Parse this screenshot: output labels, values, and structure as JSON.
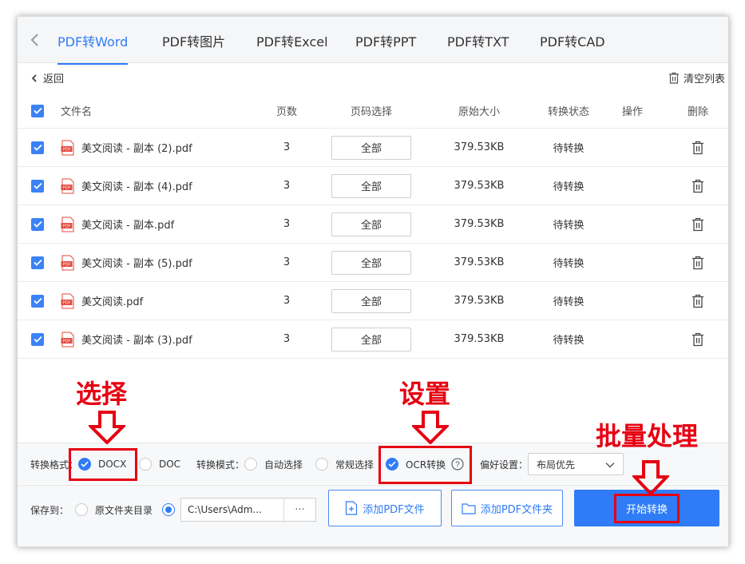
{
  "tabs": [
    {
      "label": "PDF转Word",
      "active": true
    },
    {
      "label": "PDF转图片",
      "active": false
    },
    {
      "label": "PDF转Excel",
      "active": false
    },
    {
      "label": "PDF转PPT",
      "active": false
    },
    {
      "label": "PDF转TXT",
      "active": false
    },
    {
      "label": "PDF转CAD",
      "active": false
    }
  ],
  "subheader": {
    "back_label": "返回",
    "clear_label": "清空列表"
  },
  "table": {
    "headers": {
      "name": "文件名",
      "pages": "页数",
      "range": "页码选择",
      "size": "原始大小",
      "status": "转换状态",
      "op": "操作",
      "del": "删除"
    },
    "rows": [
      {
        "name": "美文阅读 - 副本 (2).pdf",
        "pages": "3",
        "range": "全部",
        "size": "379.53KB",
        "status": "待转换"
      },
      {
        "name": "美文阅读 - 副本 (4).pdf",
        "pages": "3",
        "range": "全部",
        "size": "379.53KB",
        "status": "待转换"
      },
      {
        "name": "美文阅读 - 副本.pdf",
        "pages": "3",
        "range": "全部",
        "size": "379.53KB",
        "status": "待转换"
      },
      {
        "name": "美文阅读 - 副本 (5).pdf",
        "pages": "3",
        "range": "全部",
        "size": "379.53KB",
        "status": "待转换"
      },
      {
        "name": "美文阅读.pdf",
        "pages": "3",
        "range": "全部",
        "size": "379.53KB",
        "status": "待转换"
      },
      {
        "name": "美文阅读 - 副本 (3).pdf",
        "pages": "3",
        "range": "全部",
        "size": "379.53KB",
        "status": "待转换"
      }
    ]
  },
  "options": {
    "format_label": "转换格式：",
    "docx": "DOCX",
    "doc": "DOC",
    "mode_label": "转换模式：",
    "auto": "自动选择",
    "normal": "常规选择",
    "ocr": "OCR转换",
    "pref_label": "偏好设置：",
    "pref_value": "布局优先"
  },
  "bottom": {
    "save_label": "保存到：",
    "source_folder": "原文件夹目录",
    "path": "C:\\Users\\Adm...",
    "path_more": "···",
    "add_file": "添加PDF文件",
    "add_folder": "添加PDF文件夹",
    "start": "开始转换"
  },
  "annotations": {
    "select": "选择",
    "settings": "设置",
    "batch": "批量处理"
  },
  "colors": {
    "accent": "#2f7cf6",
    "annotation": "#e60012"
  }
}
